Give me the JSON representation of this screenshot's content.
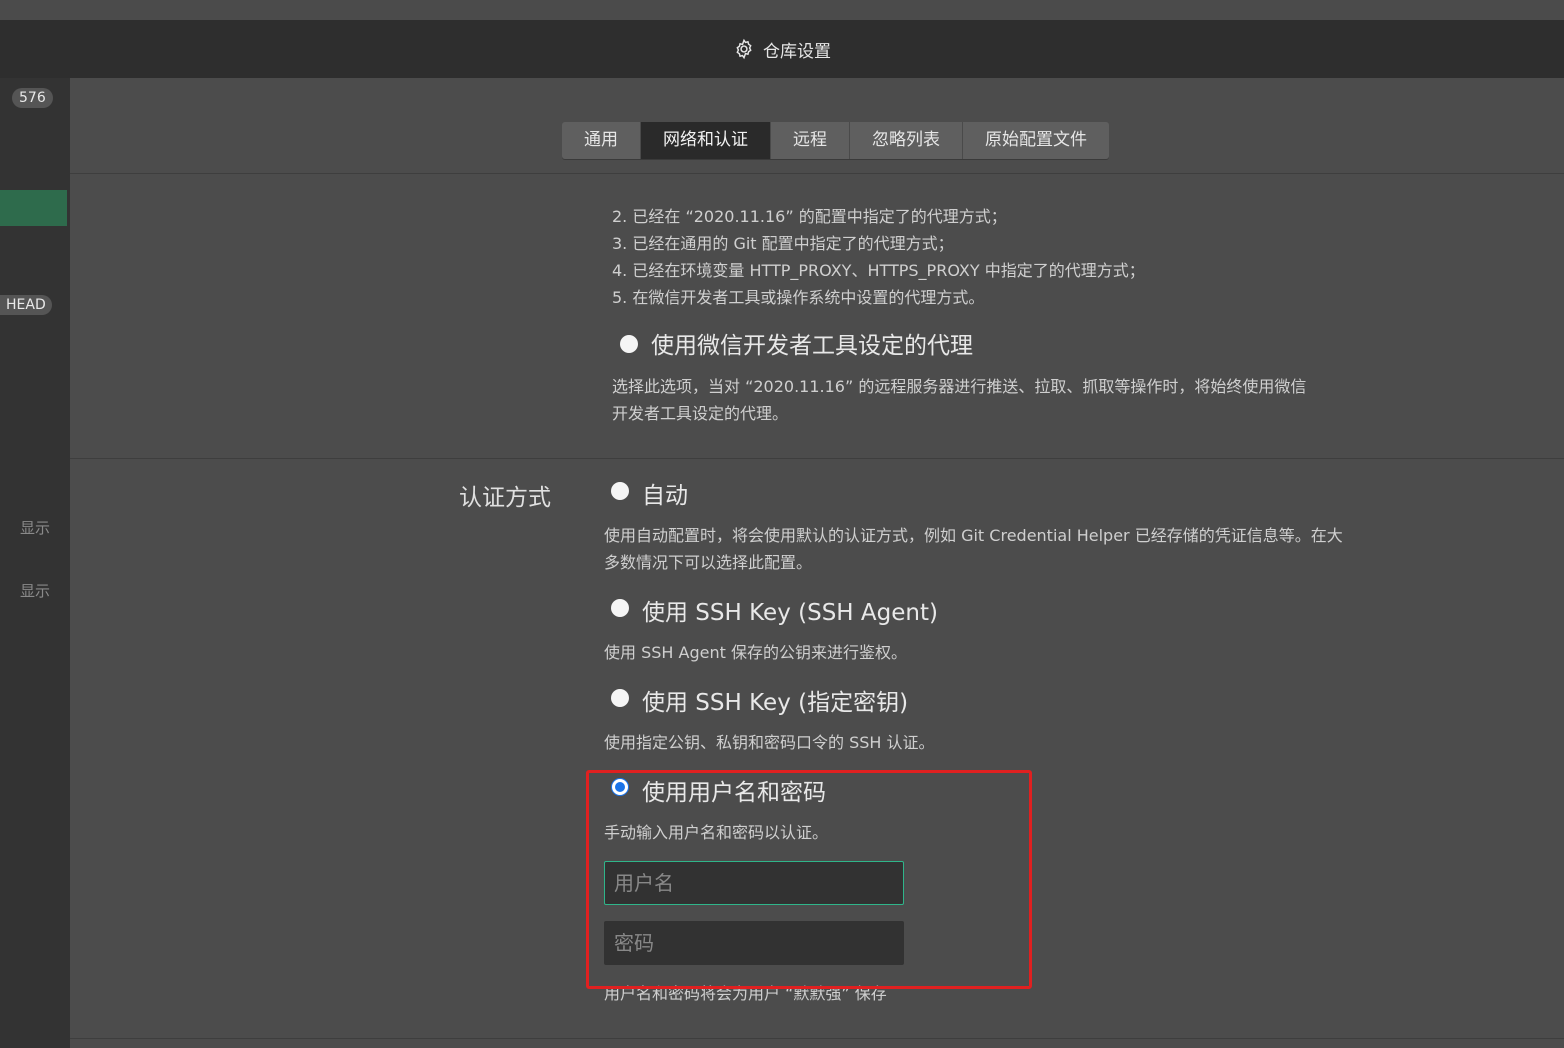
{
  "title": {
    "text": "仓库设置",
    "icon": "gear-icon"
  },
  "left_panel": {
    "count_badge": "576",
    "head_badge": "HEAD",
    "show_1": "显示",
    "show_2": "显示"
  },
  "tabs": [
    {
      "label": "通用",
      "active": false
    },
    {
      "label": "网络和认证",
      "active": true
    },
    {
      "label": "远程",
      "active": false
    },
    {
      "label": "忽略列表",
      "active": false
    },
    {
      "label": "原始配置文件",
      "active": false
    }
  ],
  "proxy": {
    "list": [
      "2. 已经在 “2020.11.16” 的配置中指定了的代理方式；",
      "3. 已经在通用的 Git 配置中指定了的代理方式；",
      "4. 已经在环境变量 HTTP_PROXY、HTTPS_PROXY 中指定了的代理方式；",
      "5. 在微信开发者工具或操作系统中设置的代理方式。"
    ],
    "wechat_option": {
      "label": "使用微信开发者工具设定的代理",
      "desc_1": "选择此选项，当对 “2020.11.16” 的远程服务器进行推送、拉取、抓取等操作时，将始终使用微信",
      "desc_2": "开发者工具设定的代理。"
    }
  },
  "auth": {
    "section_label": "认证方式",
    "options": [
      {
        "label": "自动",
        "desc_1": "使用自动配置时，将会使用默认的认证方式，例如 Git Credential Helper 已经存储的凭证信息等。在大",
        "desc_2": "多数情况下可以选择此配置。"
      },
      {
        "label": "使用 SSH Key (SSH Agent)",
        "desc_1": "使用 SSH Agent 保存的公钥来进行鉴权。"
      },
      {
        "label": "使用 SSH Key (指定密钥)",
        "desc_1": "使用指定公钥、私钥和密码口令的 SSH 认证。"
      },
      {
        "label": "使用用户名和密码",
        "desc_1": "手动输入用户名和密码以认证。",
        "selected": true
      }
    ],
    "username_placeholder": "用户名",
    "password_placeholder": "密码",
    "footer_note": "用户名和密码将会为用户 “默默强” 保存"
  },
  "colors": {
    "accent_blue": "#1a73e8",
    "focus_green": "#2fb58a",
    "highlight_red": "#e02020",
    "sidebar_selected": "#2e6b4c"
  }
}
